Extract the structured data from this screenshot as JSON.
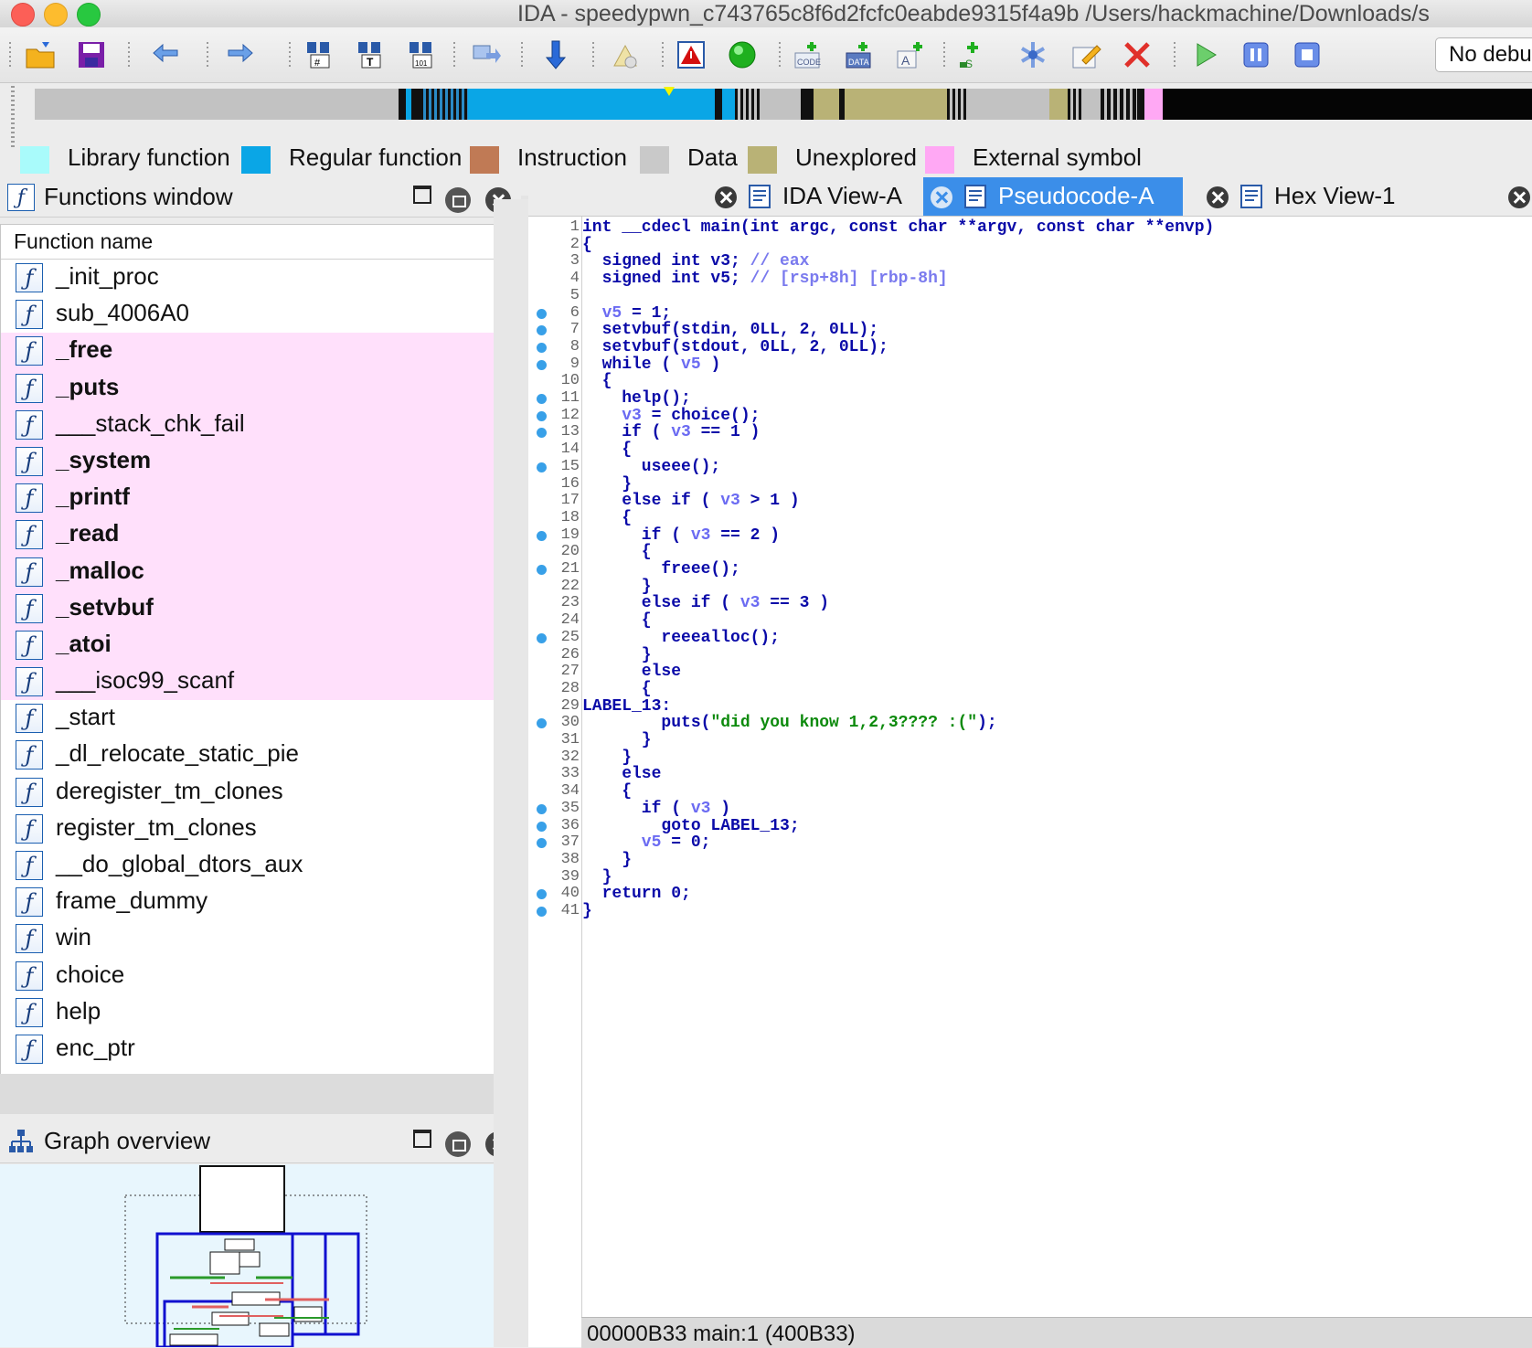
{
  "window": {
    "title": "IDA - speedypwn_c743765c8f6d2fcfc0eabde9315f4a9b /Users/hackmachine/Downloads/s"
  },
  "toolbar": {
    "debugger_select": "No debu"
  },
  "legend": [
    {
      "label": "Library function",
      "color": "#a9fbfb"
    },
    {
      "label": "Regular function",
      "color": "#0aa6e6"
    },
    {
      "label": "Instruction",
      "color": "#c07a55"
    },
    {
      "label": "Data",
      "color": "#c9c9c9"
    },
    {
      "label": "Unexplored",
      "color": "#b9b276"
    },
    {
      "label": "External symbol",
      "color": "#ffa8f4"
    }
  ],
  "functions_window": {
    "title": "Functions window",
    "column_header": "Function name",
    "functions": [
      {
        "name": "_init_proc",
        "external": false
      },
      {
        "name": "sub_4006A0",
        "external": false
      },
      {
        "name": "_free",
        "external": true
      },
      {
        "name": "_puts",
        "external": true
      },
      {
        "name": "___stack_chk_fail",
        "external": true
      },
      {
        "name": "_system",
        "external": true
      },
      {
        "name": "_printf",
        "external": true
      },
      {
        "name": "_read",
        "external": true
      },
      {
        "name": "_malloc",
        "external": true
      },
      {
        "name": "_setvbuf",
        "external": true
      },
      {
        "name": "_atoi",
        "external": true
      },
      {
        "name": "___isoc99_scanf",
        "external": true
      },
      {
        "name": "_start",
        "external": false
      },
      {
        "name": "_dl_relocate_static_pie",
        "external": false
      },
      {
        "name": "deregister_tm_clones",
        "external": false
      },
      {
        "name": "register_tm_clones",
        "external": false
      },
      {
        "name": "__do_global_dtors_aux",
        "external": false
      },
      {
        "name": "frame_dummy",
        "external": false
      },
      {
        "name": "win",
        "external": false
      },
      {
        "name": "choice",
        "external": false
      },
      {
        "name": "help",
        "external": false
      },
      {
        "name": "enc_ptr",
        "external": false
      }
    ]
  },
  "graph_overview": {
    "title": "Graph overview"
  },
  "tabs": [
    {
      "label": "IDA View-A",
      "active": false
    },
    {
      "label": "Pseudocode-A",
      "active": true
    },
    {
      "label": "Hex View-1",
      "active": false
    }
  ],
  "pseudocode": {
    "lines": [
      {
        "n": "1",
        "bp": false,
        "segs": [
          [
            "kw",
            "int __cdecl main(int argc, const char **argv, const char **envp)"
          ]
        ]
      },
      {
        "n": "2",
        "bp": false,
        "segs": [
          [
            "kw",
            "{"
          ]
        ]
      },
      {
        "n": "3",
        "bp": false,
        "segs": [
          [
            "kw",
            "  signed int v3; "
          ],
          [
            "cmt",
            "// eax"
          ]
        ]
      },
      {
        "n": "4",
        "bp": false,
        "segs": [
          [
            "kw",
            "  signed int v5; "
          ],
          [
            "cmt",
            "// [rsp+8h] [rbp-8h]"
          ]
        ]
      },
      {
        "n": "5",
        "bp": false,
        "segs": []
      },
      {
        "n": "6",
        "bp": true,
        "segs": [
          [
            "var",
            "  v5"
          ],
          [
            "kw",
            " = 1;"
          ]
        ]
      },
      {
        "n": "7",
        "bp": true,
        "segs": [
          [
            "kw",
            "  setvbuf(stdin, 0LL, 2, 0LL);"
          ]
        ]
      },
      {
        "n": "8",
        "bp": true,
        "segs": [
          [
            "kw",
            "  setvbuf(stdout, 0LL, 2, 0LL);"
          ]
        ]
      },
      {
        "n": "9",
        "bp": true,
        "segs": [
          [
            "kw",
            "  while ( "
          ],
          [
            "var",
            "v5"
          ],
          [
            "kw",
            " )"
          ]
        ]
      },
      {
        "n": "10",
        "bp": false,
        "segs": [
          [
            "kw",
            "  {"
          ]
        ]
      },
      {
        "n": "11",
        "bp": true,
        "segs": [
          [
            "kw",
            "    help();"
          ]
        ]
      },
      {
        "n": "12",
        "bp": true,
        "segs": [
          [
            "var",
            "    v3"
          ],
          [
            "kw",
            " = choice();"
          ]
        ]
      },
      {
        "n": "13",
        "bp": true,
        "segs": [
          [
            "kw",
            "    if ( "
          ],
          [
            "var",
            "v3"
          ],
          [
            "kw",
            " == 1 )"
          ]
        ]
      },
      {
        "n": "14",
        "bp": false,
        "segs": [
          [
            "kw",
            "    {"
          ]
        ]
      },
      {
        "n": "15",
        "bp": true,
        "segs": [
          [
            "kw",
            "      useee();"
          ]
        ]
      },
      {
        "n": "16",
        "bp": false,
        "segs": [
          [
            "kw",
            "    }"
          ]
        ]
      },
      {
        "n": "17",
        "bp": false,
        "segs": [
          [
            "kw",
            "    else if ( "
          ],
          [
            "var",
            "v3"
          ],
          [
            "kw",
            " > 1 )"
          ]
        ]
      },
      {
        "n": "18",
        "bp": false,
        "segs": [
          [
            "kw",
            "    {"
          ]
        ]
      },
      {
        "n": "19",
        "bp": true,
        "segs": [
          [
            "kw",
            "      if ( "
          ],
          [
            "var",
            "v3"
          ],
          [
            "kw",
            " == 2 )"
          ]
        ]
      },
      {
        "n": "20",
        "bp": false,
        "segs": [
          [
            "kw",
            "      {"
          ]
        ]
      },
      {
        "n": "21",
        "bp": true,
        "segs": [
          [
            "kw",
            "        freee();"
          ]
        ]
      },
      {
        "n": "22",
        "bp": false,
        "segs": [
          [
            "kw",
            "      }"
          ]
        ]
      },
      {
        "n": "23",
        "bp": false,
        "segs": [
          [
            "kw",
            "      else if ( "
          ],
          [
            "var",
            "v3"
          ],
          [
            "kw",
            " == 3 )"
          ]
        ]
      },
      {
        "n": "24",
        "bp": false,
        "segs": [
          [
            "kw",
            "      {"
          ]
        ]
      },
      {
        "n": "25",
        "bp": true,
        "segs": [
          [
            "kw",
            "        reeealloc();"
          ]
        ]
      },
      {
        "n": "26",
        "bp": false,
        "segs": [
          [
            "kw",
            "      }"
          ]
        ]
      },
      {
        "n": "27",
        "bp": false,
        "segs": [
          [
            "kw",
            "      else"
          ]
        ]
      },
      {
        "n": "28",
        "bp": false,
        "segs": [
          [
            "kw",
            "      {"
          ]
        ]
      },
      {
        "n": "29",
        "bp": false,
        "segs": [
          [
            "kw",
            "LABEL_13:"
          ]
        ]
      },
      {
        "n": "30",
        "bp": true,
        "segs": [
          [
            "kw",
            "        puts("
          ],
          [
            "str",
            "\"did you know 1,2,3???? :(\""
          ],
          [
            "kw",
            ");"
          ]
        ]
      },
      {
        "n": "31",
        "bp": false,
        "segs": [
          [
            "kw",
            "      }"
          ]
        ]
      },
      {
        "n": "32",
        "bp": false,
        "segs": [
          [
            "kw",
            "    }"
          ]
        ]
      },
      {
        "n": "33",
        "bp": false,
        "segs": [
          [
            "kw",
            "    else"
          ]
        ]
      },
      {
        "n": "34",
        "bp": false,
        "segs": [
          [
            "kw",
            "    {"
          ]
        ]
      },
      {
        "n": "35",
        "bp": true,
        "segs": [
          [
            "kw",
            "      if ( "
          ],
          [
            "var",
            "v3"
          ],
          [
            "kw",
            " )"
          ]
        ]
      },
      {
        "n": "36",
        "bp": true,
        "segs": [
          [
            "kw",
            "        goto LABEL_13;"
          ]
        ]
      },
      {
        "n": "37",
        "bp": true,
        "segs": [
          [
            "var",
            "      v5"
          ],
          [
            "kw",
            " = 0;"
          ]
        ]
      },
      {
        "n": "38",
        "bp": false,
        "segs": [
          [
            "kw",
            "    }"
          ]
        ]
      },
      {
        "n": "39",
        "bp": false,
        "segs": [
          [
            "kw",
            "  }"
          ]
        ]
      },
      {
        "n": "40",
        "bp": true,
        "segs": [
          [
            "kw",
            "  return 0;"
          ]
        ]
      },
      {
        "n": "41",
        "bp": true,
        "segs": [
          [
            "kw",
            "}"
          ]
        ]
      }
    ],
    "status": "00000B33  main:1 (400B33)"
  },
  "icons": {
    "toolbar": [
      "open-folder-icon",
      "save-icon",
      "back-arrow-icon",
      "forward-arrow-icon",
      "search-binary-icon",
      "search-text-icon",
      "search-hex-icon",
      "jump-icon",
      "step-down-icon",
      "disabled-icon",
      "warning-icon",
      "run-green-icon",
      "code-icon",
      "data-icon",
      "add-text-icon",
      "add-struct-icon",
      "asterisk-icon",
      "edit-icon",
      "delete-icon",
      "play-icon",
      "pause-icon",
      "stop-icon"
    ]
  }
}
